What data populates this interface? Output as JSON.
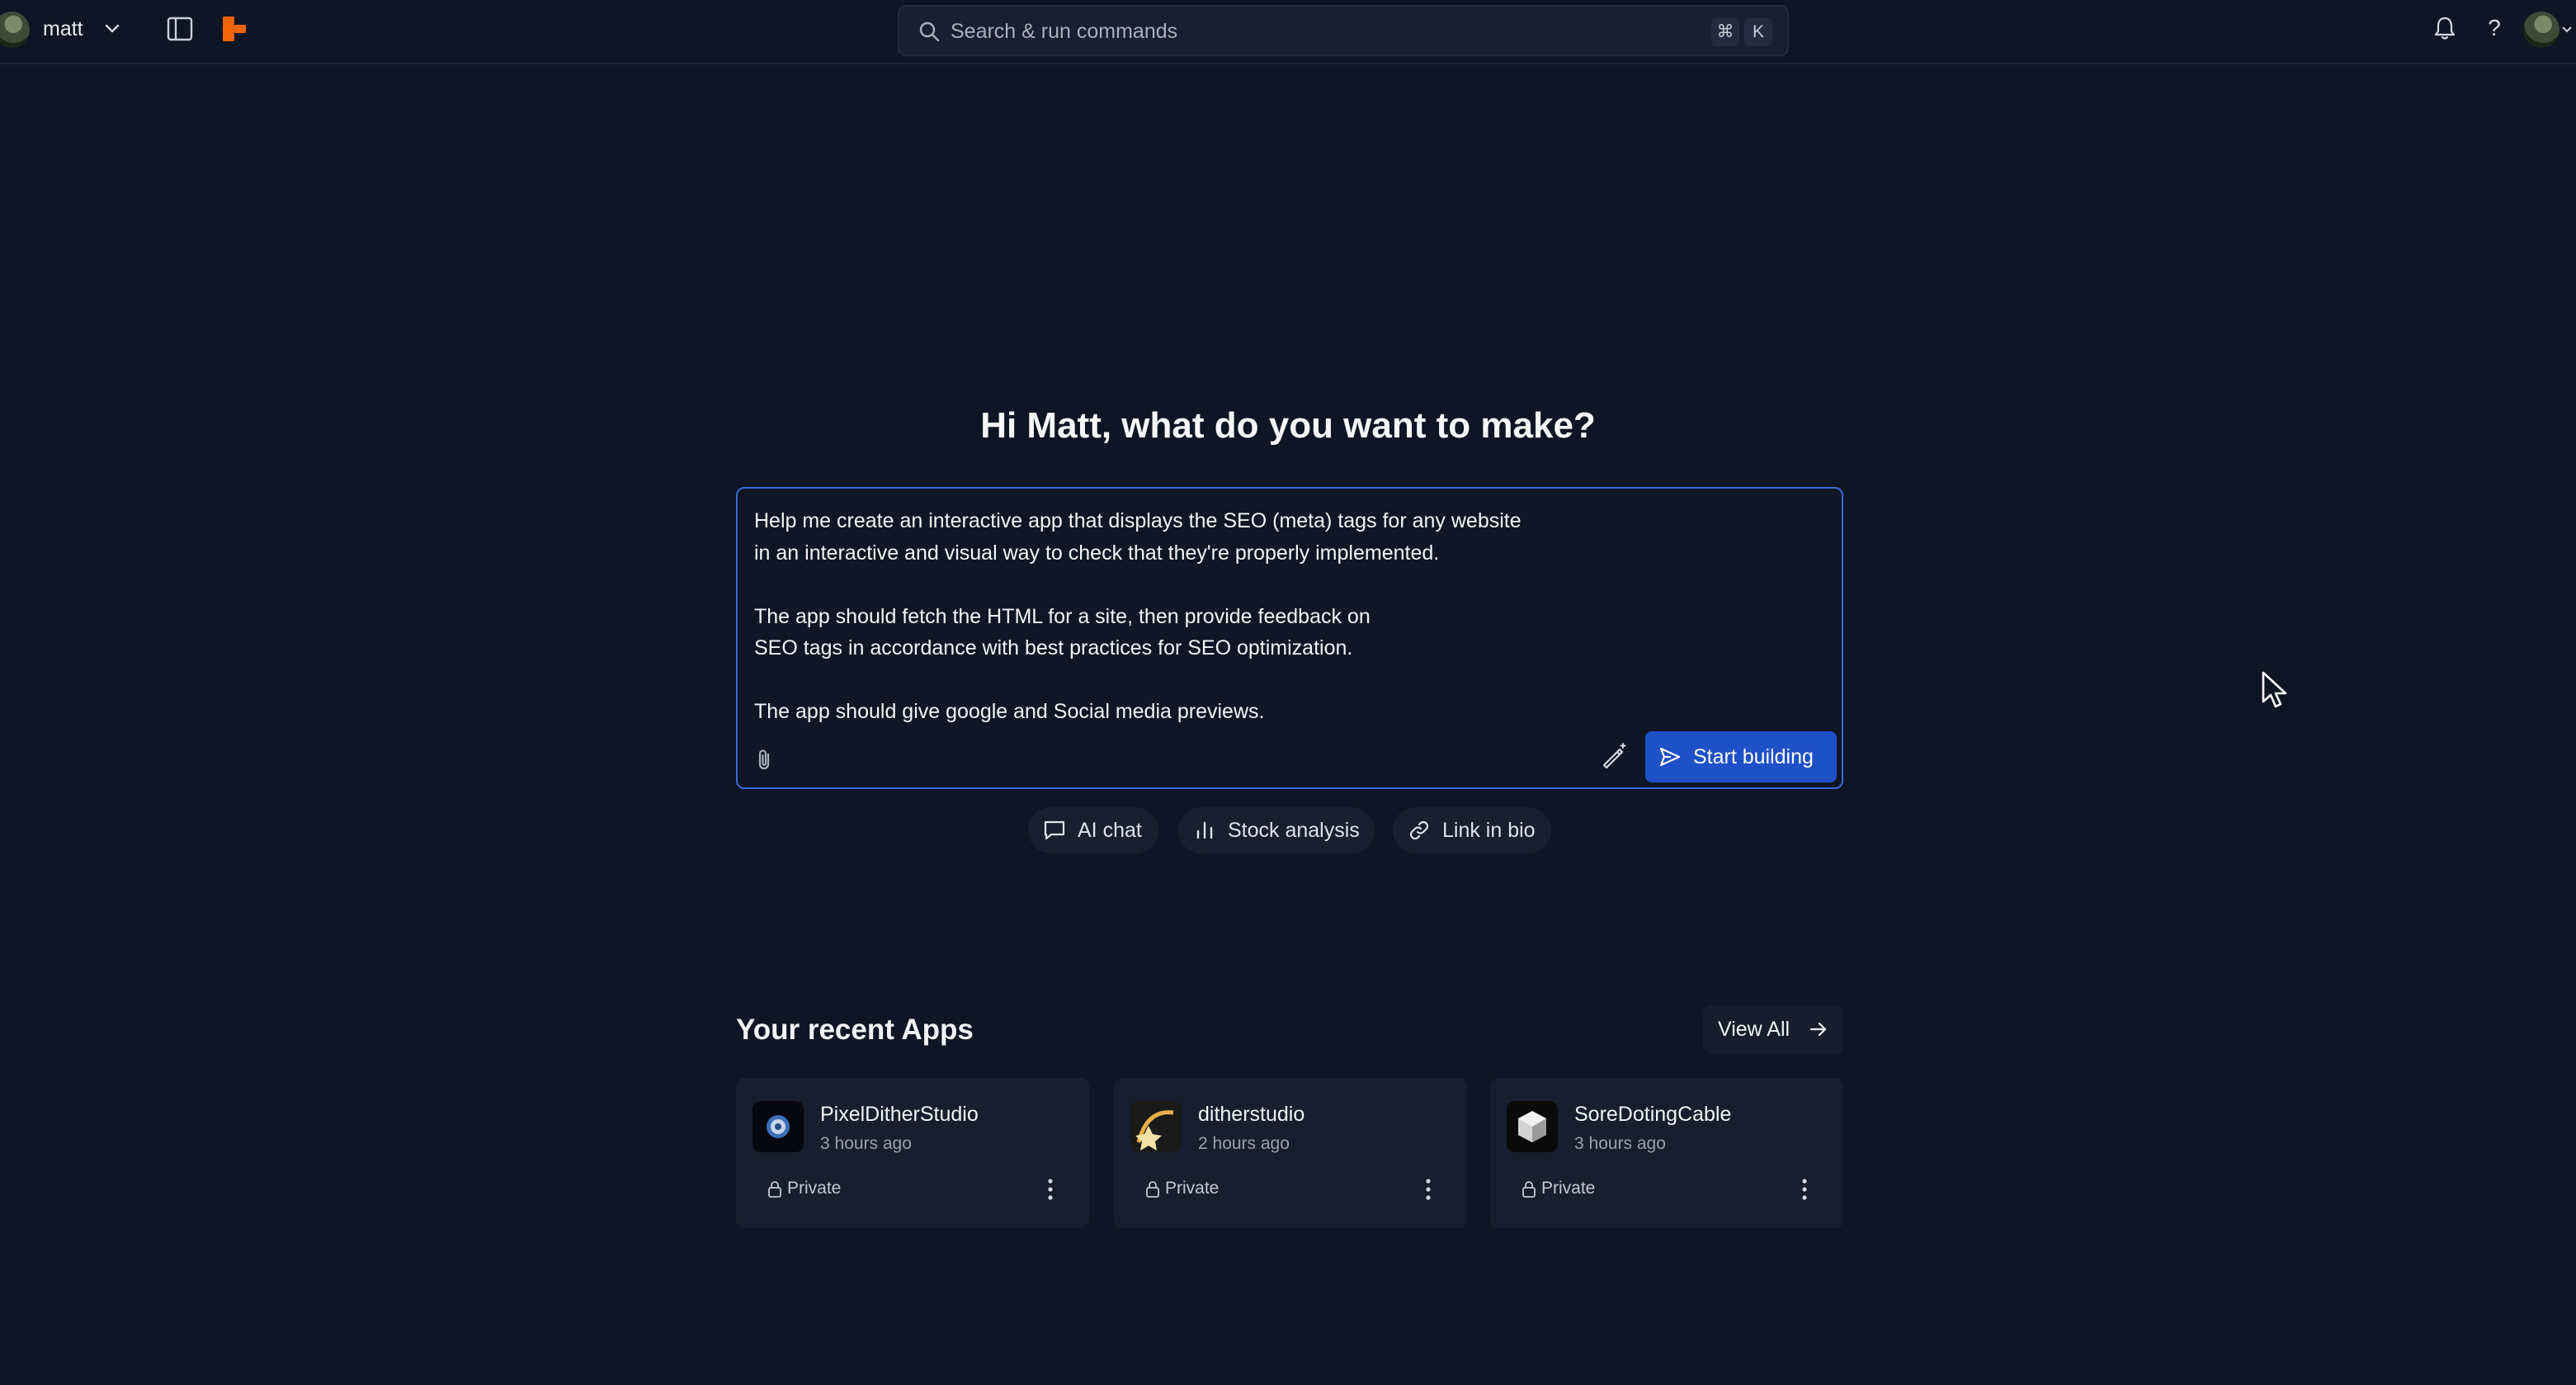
{
  "topbar": {
    "username": "matt",
    "search_placeholder": "Search & run commands",
    "shortcut_cmd": "⌘",
    "shortcut_key": "K",
    "help_glyph": "?"
  },
  "main": {
    "greeting": "Hi Matt, what do you want to make?",
    "prompt_text": "Help me create an interactive app that displays the SEO (meta) tags for any website\nin an interactive and visual way to check that they're properly implemented.\n\nThe app should fetch the HTML for a site, then provide feedback on\nSEO tags in accordance with best practices for SEO optimization.\n\nThe app should give google and Social media previews.",
    "start_button": "Start building",
    "chips": [
      {
        "label": "AI chat",
        "icon": "chat-bubble-icon"
      },
      {
        "label": "Stock analysis",
        "icon": "bar-chart-icon"
      },
      {
        "label": "Link in bio",
        "icon": "link-icon"
      }
    ]
  },
  "recent": {
    "title": "Your recent Apps",
    "view_all": "View All",
    "apps": [
      {
        "name": "PixelDitherStudio",
        "time": "3 hours ago",
        "privacy": "Private"
      },
      {
        "name": "ditherstudio",
        "time": "2 hours ago",
        "privacy": "Private"
      },
      {
        "name": "SoreDotingCable",
        "time": "3 hours ago",
        "privacy": "Private"
      }
    ]
  },
  "colors": {
    "background": "#0e1524",
    "accent": "#1e50c8",
    "prompt_border": "#3a6ad8",
    "logo": "#f26207"
  }
}
